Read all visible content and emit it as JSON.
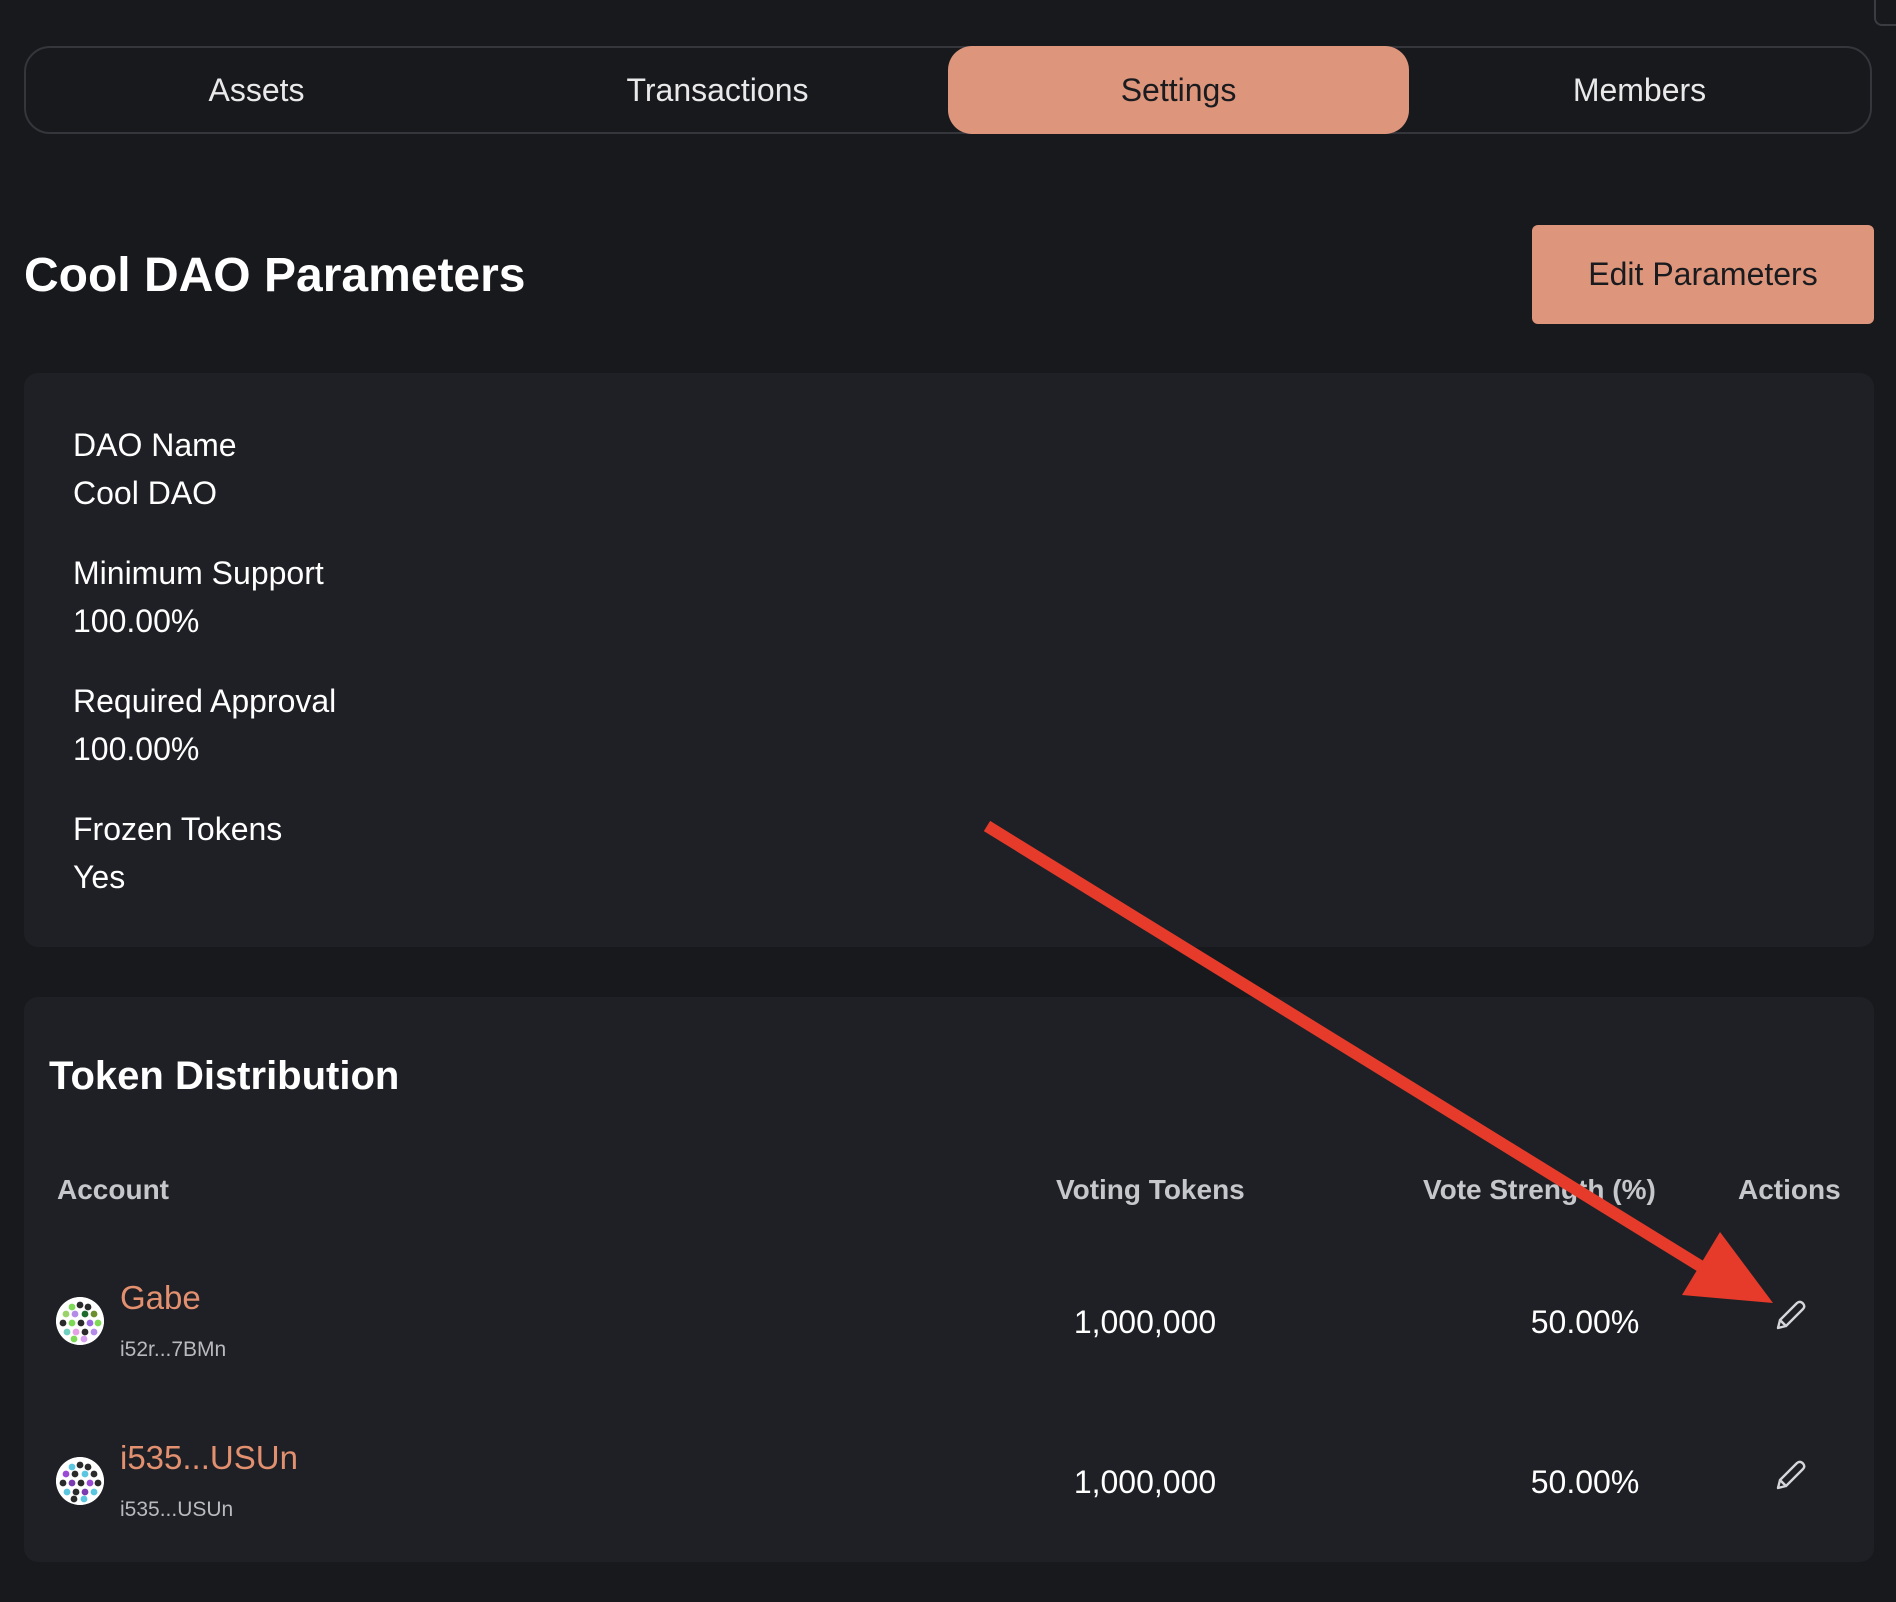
{
  "tabs": [
    {
      "label": "Assets",
      "active": false
    },
    {
      "label": "Transactions",
      "active": false
    },
    {
      "label": "Settings",
      "active": true
    },
    {
      "label": "Members",
      "active": false
    }
  ],
  "header": {
    "title": "Cool DAO Parameters",
    "edit_button_label": "Edit Parameters"
  },
  "parameters": [
    {
      "label": "DAO Name",
      "value": "Cool DAO"
    },
    {
      "label": "Minimum Support",
      "value": "100.00%"
    },
    {
      "label": "Required Approval",
      "value": "100.00%"
    },
    {
      "label": "Frozen Tokens",
      "value": "Yes"
    }
  ],
  "token_distribution": {
    "title": "Token Distribution",
    "columns": {
      "account": "Account",
      "voting_tokens": "Voting Tokens",
      "vote_strength": "Vote Strength (%)",
      "actions": "Actions"
    },
    "rows": [
      {
        "name": "Gabe",
        "address": "i52r...7BMn",
        "voting_tokens": "1,000,000",
        "vote_strength": "50.00%",
        "action_icon": "pencil-icon"
      },
      {
        "name": "i535...USUn",
        "address": "i535...USUn",
        "voting_tokens": "1,000,000",
        "vote_strength": "50.00%",
        "action_icon": "pencil-icon"
      }
    ]
  },
  "colors": {
    "background": "#18191d",
    "card": "#1f2025",
    "accent": "#dd957b",
    "link": "#e2906f",
    "annotation_arrow": "#e63b2a"
  }
}
